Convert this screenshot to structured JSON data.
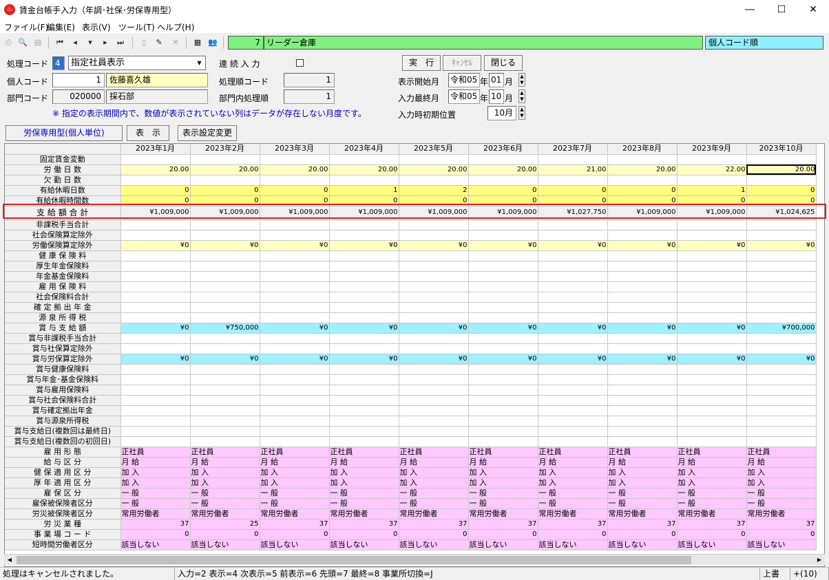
{
  "window": {
    "title": "賃金台帳手入力（年調･社保･労保専用型）",
    "minimize": "―",
    "maximize": "☐",
    "close": "✕"
  },
  "menu": [
    "ファイル(F)",
    "編集(E)",
    "表示(V)",
    "ツール(T)",
    "ヘルプ(H)"
  ],
  "toolbar": {
    "company_code": "7",
    "company_name": "リーダー倉庫",
    "sort_order": "個人コード順"
  },
  "form": {
    "process_code_label": "処理コード",
    "process_code": "4",
    "process_option": "指定社員表示",
    "continuous_input_label": "連 続 入 力",
    "personal_code_label": "個人コード",
    "personal_code": "1",
    "employee_name": "佐藤喜久雄",
    "processing_order_label": "処理順コード",
    "processing_order": "1",
    "dept_code_label": "部門コード",
    "dept_code": "020000",
    "dept_name": "採石部",
    "dept_order_label": "部門内処理順",
    "dept_order": "1",
    "execute": "実　行",
    "cancel": "ｷｬﾝｾﾙ",
    "close": "閉じる",
    "display_start_label": "表示開始月",
    "display_start_era": "令和05",
    "display_start_year_suffix": "年",
    "display_start_month": "01",
    "display_start_month_suffix": "月",
    "input_end_label": "入力最終月",
    "input_end_era": "令和05",
    "input_end_year_suffix": "年",
    "input_end_month": "10",
    "input_end_month_suffix": "月",
    "initial_position_label": "入力時初期位置",
    "initial_position": "10月",
    "note": "※ 指定の表示期間内で、数値が表示されていない列はデータが存在しない月度です。"
  },
  "tabs": {
    "mode": "労保専用型(個人単位)",
    "display": "表　示",
    "settings": "表示設定変更"
  },
  "grid": {
    "months": [
      "2023年1月",
      "2023年2月",
      "2023年3月",
      "2023年4月",
      "2023年5月",
      "2023年6月",
      "2023年7月",
      "2023年8月",
      "2023年9月",
      "2023年10月"
    ],
    "rows": [
      {
        "label": "固定賃金変動",
        "style": "n",
        "values": []
      },
      {
        "label": "労 働 日 数",
        "style": "y",
        "values": [
          "20.00",
          "20.00",
          "20.00",
          "20.00",
          "20.00",
          "20.00",
          "21.00",
          "20.00",
          "22.00",
          "20.00"
        ]
      },
      {
        "label": "欠 勤 日 数",
        "style": "n",
        "values": []
      },
      {
        "label": "有給休暇日数",
        "style": "Y",
        "values": [
          "0",
          "0",
          "0",
          "1",
          "2",
          "0",
          "0",
          "0",
          "1",
          "0"
        ]
      },
      {
        "label": "有給休暇時間数",
        "style": "Y",
        "values": [
          "0",
          "0",
          "0",
          "0",
          "0",
          "0",
          "0",
          "0",
          "0",
          "0"
        ]
      },
      {
        "label": "支 給 額 合 計",
        "style": "w",
        "values": [
          "¥1,009,000",
          "¥1,009,000",
          "¥1,009,000",
          "¥1,009,000",
          "¥1,009,000",
          "¥1,009,000",
          "¥1,027,750",
          "¥1,009,000",
          "¥1,009,000",
          "¥1,024,625"
        ]
      },
      {
        "label": "非課税手当合計",
        "style": "n",
        "values": []
      },
      {
        "label": "社会保険算定除外",
        "style": "n",
        "values": []
      },
      {
        "label": "労働保険算定除外",
        "style": "y",
        "values": [
          "¥0",
          "¥0",
          "¥0",
          "¥0",
          "¥0",
          "¥0",
          "¥0",
          "¥0",
          "¥0",
          "¥0"
        ]
      },
      {
        "label": "健 康 保 険 料",
        "style": "n",
        "values": []
      },
      {
        "label": "厚生年金保険料",
        "style": "n",
        "values": []
      },
      {
        "label": "年金基金保険料",
        "style": "n",
        "values": []
      },
      {
        "label": "雇 用 保 険 料",
        "style": "n",
        "values": []
      },
      {
        "label": "社会保険料合計",
        "style": "n",
        "values": []
      },
      {
        "label": "確 定 拠 出 年 金",
        "style": "n",
        "values": []
      },
      {
        "label": "源 泉 所 得 税",
        "style": "n",
        "values": []
      },
      {
        "label": "賞 与 支 給 額",
        "style": "c",
        "values": [
          "¥0",
          "¥750,000",
          "¥0",
          "¥0",
          "¥0",
          "¥0",
          "¥0",
          "¥0",
          "¥0",
          "¥700,000"
        ]
      },
      {
        "label": "賞与非課税手当合計",
        "style": "n",
        "values": []
      },
      {
        "label": "賞与社保算定除外",
        "style": "n",
        "values": []
      },
      {
        "label": "賞与労保算定除外",
        "style": "c",
        "values": [
          "¥0",
          "¥0",
          "¥0",
          "¥0",
          "¥0",
          "¥0",
          "¥0",
          "¥0",
          "¥0",
          "¥0"
        ]
      },
      {
        "label": "賞与健康保険料",
        "style": "n",
        "values": []
      },
      {
        "label": "賞与年金･基金保険料",
        "style": "n",
        "values": []
      },
      {
        "label": "賞与雇用保険料",
        "style": "n",
        "values": []
      },
      {
        "label": "賞与社会保険料合計",
        "style": "n",
        "values": []
      },
      {
        "label": "賞与確定拠出年金",
        "style": "n",
        "values": []
      },
      {
        "label": "賞与源泉所得税",
        "style": "n",
        "values": []
      },
      {
        "label": "賞与支給日(複数回は最終日)",
        "style": "n",
        "values": []
      },
      {
        "label": "賞与支給日(複数回の初回日)",
        "style": "n",
        "values": []
      },
      {
        "label": "雇 用 形 態",
        "style": "p",
        "values": [
          "正社員",
          "正社員",
          "正社員",
          "正社員",
          "正社員",
          "正社員",
          "正社員",
          "正社員",
          "正社員",
          "正社員"
        ]
      },
      {
        "label": "給 与 区 分",
        "style": "p",
        "values": [
          "月 給",
          "月 給",
          "月 給",
          "月 給",
          "月 給",
          "月 給",
          "月 給",
          "月 給",
          "月 給",
          "月 給"
        ]
      },
      {
        "label": "健 保 適 用 区 分",
        "style": "p",
        "values": [
          "加 入",
          "加 入",
          "加 入",
          "加 入",
          "加 入",
          "加 入",
          "加 入",
          "加 入",
          "加 入",
          "加 入"
        ]
      },
      {
        "label": "厚 年 適 用 区 分",
        "style": "p",
        "values": [
          "加 入",
          "加 入",
          "加 入",
          "加 入",
          "加 入",
          "加 入",
          "加 入",
          "加 入",
          "加 入",
          "加 入"
        ]
      },
      {
        "label": "雇 保 区 分",
        "style": "p",
        "values": [
          "一 般",
          "一 般",
          "一 般",
          "一 般",
          "一 般",
          "一 般",
          "一 般",
          "一 般",
          "一 般",
          "一 般"
        ]
      },
      {
        "label": "雇保被保険者区分",
        "style": "p",
        "values": [
          "一 般",
          "一 般",
          "一 般",
          "一 般",
          "一 般",
          "一 般",
          "一 般",
          "一 般",
          "一 般",
          "一 般"
        ]
      },
      {
        "label": "労災被保険者区分",
        "style": "p",
        "values": [
          "常用労働者",
          "常用労働者",
          "常用労働者",
          "常用労働者",
          "常用労働者",
          "常用労働者",
          "常用労働者",
          "常用労働者",
          "常用労働者",
          "常用労働者"
        ]
      },
      {
        "label": "労 災 業 種",
        "style": "pv",
        "values": [
          "37",
          "25",
          "37",
          "37",
          "37",
          "37",
          "37",
          "37",
          "37",
          "37"
        ]
      },
      {
        "label": "事 業 場 コ ー ド",
        "style": "pv",
        "values": [
          "0",
          "0",
          "0",
          "0",
          "0",
          "0",
          "0",
          "0",
          "0",
          "0"
        ]
      },
      {
        "label": "短時間労働者区分",
        "style": "p",
        "values": [
          "該当しない",
          "該当しない",
          "該当しない",
          "該当しない",
          "該当しない",
          "該当しない",
          "該当しない",
          "該当しない",
          "該当しない",
          "該当しない"
        ]
      }
    ]
  },
  "status": {
    "message": "処理はキャンセルされました。",
    "keys": "入力=2 表示=4 次表示=5 前表示=6 先頭=7 最終=8 事業所切換=J",
    "mode": "上書",
    "extra": "+(10)"
  }
}
